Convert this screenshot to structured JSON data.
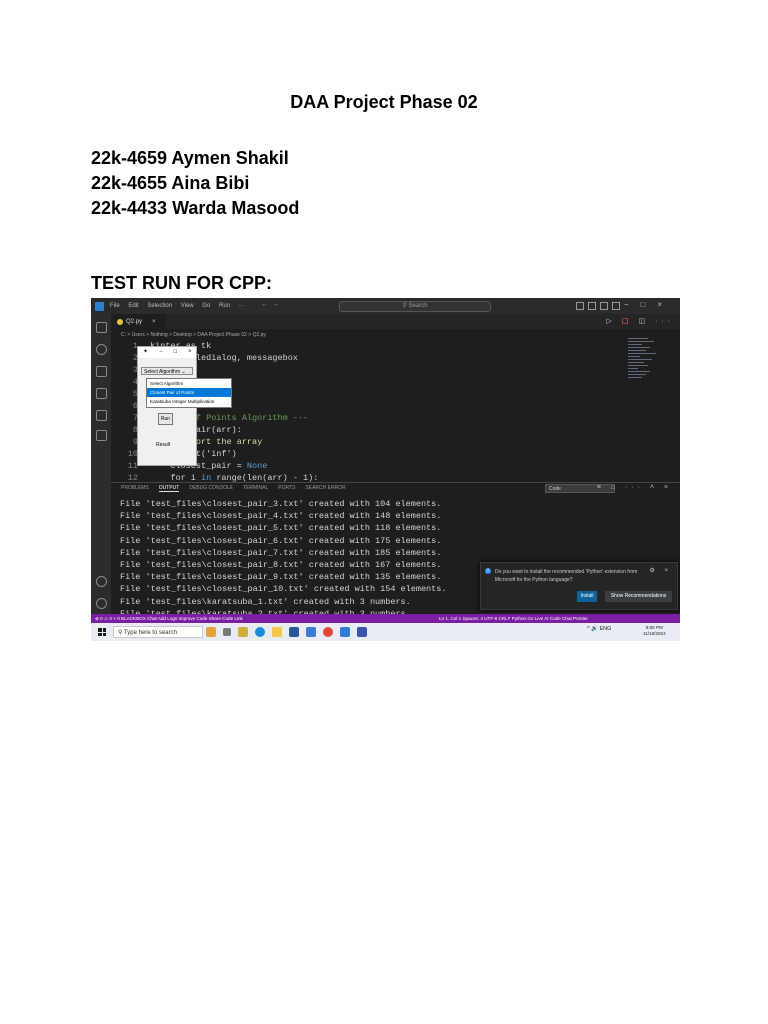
{
  "document": {
    "title": "DAA Project Phase 02",
    "members": [
      "22k-4659 Aymen Shakil",
      "22k-4655 Aina Bibi",
      "22k-4433 Warda Masood"
    ],
    "section_heading": "TEST RUN FOR CPP:"
  },
  "vscode": {
    "menu": [
      "File",
      "Edit",
      "Selection",
      "View",
      "Go",
      "Run",
      "···"
    ],
    "search_placeholder": "Search",
    "tab_label": "Q2.py",
    "breadcrumb": "C: > Users > Nothing > Desktop > DAA Project Phase 02 > Q2.py",
    "code_lines": [
      {
        "n": "1",
        "pre": "",
        "kw": "",
        "text": "kinter as tk"
      },
      {
        "n": "2",
        "pre": "",
        "kw": "import",
        "text": " filedialog, messagebox"
      },
      {
        "n": "3",
        "pre": "",
        "kw": "",
        "text": "dom"
      },
      {
        "n": "4",
        "pre": "",
        "kw": "",
        "text": ""
      },
      {
        "n": "5",
        "pre": "",
        "kw": "",
        "text": ""
      },
      {
        "n": "6",
        "pre": "",
        "kw": "",
        "text": ""
      },
      {
        "n": "7",
        "pre": "",
        "kw": "",
        "text": "st Pair of Points Algorithm ---"
      },
      {
        "n": "8",
        "pre": "",
        "kw": "",
        "text": "closest_pair(arr):"
      },
      {
        "n": "9",
        "pre": "",
        "kw": "",
        "text": "rt()  # Sort the array"
      },
      {
        "n": "10",
        "pre": "",
        "kw": "",
        "text": "ff = float('inf')"
      },
      {
        "n": "11",
        "pre": "    closest_pair = ",
        "kw": "None",
        "text": ""
      },
      {
        "n": "12",
        "pre": "    for i ",
        "kw": "in",
        "text": " range(len(arr) - 1):"
      }
    ],
    "tk_window": {
      "select_label": "Select Algorithm",
      "run_label": "Run",
      "result_label": "Result",
      "dropdown_options": [
        "Select Algorithm",
        "Closest Pair of Points",
        "Karatsuba Integer Multiplication"
      ],
      "selected_option": "Closest Pair of Points"
    },
    "panel_tabs": [
      "PROBLEMS",
      "OUTPUT",
      "DEBUG CONSOLE",
      "TERMINAL",
      "PORTS",
      "SEARCH ERROR"
    ],
    "active_panel_tab": "OUTPUT",
    "output_filter": "Code",
    "output_lines": [
      "File 'test_files\\closest_pair_3.txt' created with 104 elements.",
      "File 'test_files\\closest_pair_4.txt' created with 148 elements.",
      "File 'test_files\\closest_pair_5.txt' created with 118 elements.",
      "File 'test_files\\closest_pair_6.txt' created with 175 elements.",
      "File 'test_files\\closest_pair_7.txt' created with 185 elements.",
      "File 'test_files\\closest_pair_8.txt' created with 167 elements.",
      "File 'test_files\\closest_pair_9.txt' created with 135 elements.",
      "File 'test_files\\closest_pair_10.txt' created with 154 elements.",
      "File 'test_files\\karatsuba_1.txt' created with 3 numbers.",
      "File 'test_files\\karatsuba_2.txt' created with 3 numbers."
    ],
    "notification": {
      "text": "Do you want to install the recommended 'Python' extension from Microsoft for the Python language?",
      "install_label": "Install",
      "show_label": "Show Recommendations"
    },
    "status_left": "⊗ 0 ⚠ 0   ⑂ 0   BLACKBOX Chat   Add Logs   Improve Code   Share Code Link",
    "status_right": "Ln 1, Col 1   Spaces: 4   UTF-8   CRLF   Python   Go Live   AI Code Chat   Prettier"
  },
  "taskbar": {
    "search_placeholder": "Type here to search",
    "tray": "^  🔊  ENG",
    "time": "9:00 PM",
    "date": "11/16/2024"
  }
}
